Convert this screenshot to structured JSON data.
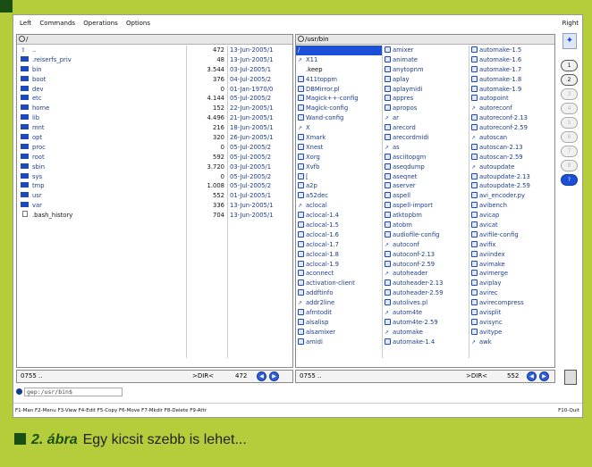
{
  "menu": {
    "items": [
      "Left",
      "Commands",
      "Operations",
      "Options"
    ],
    "right": "Right"
  },
  "left_panel": {
    "path": "/",
    "files": [
      {
        "name": "..",
        "size": "472",
        "date": "13-Jun-2005/1",
        "icon": "up"
      },
      {
        "name": ".reiserfs_priv",
        "size": "48",
        "date": "13-Jun-2005/1",
        "icon": "dir"
      },
      {
        "name": "bin",
        "size": "3.544",
        "date": "03-Jul-2005/1",
        "icon": "dir"
      },
      {
        "name": "boot",
        "size": "376",
        "date": "04-Jul-2005/2",
        "icon": "dir"
      },
      {
        "name": "dev",
        "size": "0",
        "date": "01-Jan-1970/0",
        "icon": "dir"
      },
      {
        "name": "etc",
        "size": "4.144",
        "date": "05-Jul-2005/2",
        "icon": "dir"
      },
      {
        "name": "home",
        "size": "152",
        "date": "22-Jun-2005/1",
        "icon": "dir"
      },
      {
        "name": "lib",
        "size": "4.496",
        "date": "21-Jun-2005/1",
        "icon": "dir"
      },
      {
        "name": "mnt",
        "size": "216",
        "date": "18-Jun-2005/1",
        "icon": "dir"
      },
      {
        "name": "opt",
        "size": "320",
        "date": "26-Jun-2005/1",
        "icon": "dir"
      },
      {
        "name": "proc",
        "size": "0",
        "date": "05-Jul-2005/2",
        "icon": "dir"
      },
      {
        "name": "root",
        "size": "592",
        "date": "05-Jul-2005/2",
        "icon": "dir"
      },
      {
        "name": "sbin",
        "size": "3.720",
        "date": "03-Jul-2005/1",
        "icon": "dir"
      },
      {
        "name": "sys",
        "size": "0",
        "date": "05-Jul-2005/2",
        "icon": "dir"
      },
      {
        "name": "tmp",
        "size": "1.008",
        "date": "05-Jul-2005/2",
        "icon": "dir"
      },
      {
        "name": "usr",
        "size": "552",
        "date": "01-Jul-2005/1",
        "icon": "dir"
      },
      {
        "name": "var",
        "size": "336",
        "date": "13-Jun-2005/1",
        "icon": "dir"
      },
      {
        "name": ".bash_history",
        "size": "704",
        "date": "13-Jun-2005/1",
        "icon": "file"
      }
    ],
    "status": {
      "perm": "0755 ..",
      "type": ">DIR<",
      "size": "472"
    }
  },
  "right_panel": {
    "path": "/usr/bin",
    "col1": [
      {
        "name": "/",
        "sel": true
      },
      {
        "name": "X11",
        "icon": "link"
      },
      {
        "name": ".keep",
        "icon": "none"
      },
      {
        "name": "411toppm",
        "icon": "bin"
      },
      {
        "name": "DBMirror.pl",
        "icon": "bin"
      },
      {
        "name": "Magick++-config",
        "icon": "bin"
      },
      {
        "name": "Magick-config",
        "icon": "bin"
      },
      {
        "name": "Wand-config",
        "icon": "bin"
      },
      {
        "name": "X",
        "icon": "link"
      },
      {
        "name": "Xmark",
        "icon": "bin"
      },
      {
        "name": "Xnest",
        "icon": "bin"
      },
      {
        "name": "Xorg",
        "icon": "bin"
      },
      {
        "name": "Xvfb",
        "icon": "bin"
      },
      {
        "name": "[",
        "icon": "bin"
      },
      {
        "name": "a2p",
        "icon": "bin"
      },
      {
        "name": "a52dec",
        "icon": "bin"
      },
      {
        "name": "aclocal",
        "icon": "link"
      },
      {
        "name": "aclocal-1.4",
        "icon": "bin"
      },
      {
        "name": "aclocal-1.5",
        "icon": "bin"
      },
      {
        "name": "aclocal-1.6",
        "icon": "bin"
      },
      {
        "name": "aclocal-1.7",
        "icon": "bin"
      },
      {
        "name": "aclocal-1.8",
        "icon": "bin"
      },
      {
        "name": "aclocal-1.9",
        "icon": "bin"
      },
      {
        "name": "aconnect",
        "icon": "bin"
      },
      {
        "name": "activation-client",
        "icon": "bin"
      },
      {
        "name": "addftinfo",
        "icon": "bin"
      },
      {
        "name": "addr2line",
        "icon": "link"
      },
      {
        "name": "afmtodit",
        "icon": "bin"
      },
      {
        "name": "alsalisp",
        "icon": "bin"
      },
      {
        "name": "alsamixer",
        "icon": "bin"
      },
      {
        "name": "amidi",
        "icon": "bin"
      }
    ],
    "col2": [
      {
        "name": "amixer",
        "icon": "bin"
      },
      {
        "name": "animate",
        "icon": "bin"
      },
      {
        "name": "anytopnm",
        "icon": "bin"
      },
      {
        "name": "aplay",
        "icon": "bin"
      },
      {
        "name": "aplaymidi",
        "icon": "bin"
      },
      {
        "name": "appres",
        "icon": "bin"
      },
      {
        "name": "apropos",
        "icon": "bin"
      },
      {
        "name": "ar",
        "icon": "link"
      },
      {
        "name": "arecord",
        "icon": "bin"
      },
      {
        "name": "arecordmidi",
        "icon": "bin"
      },
      {
        "name": "as",
        "icon": "link"
      },
      {
        "name": "asciitopgm",
        "icon": "bin"
      },
      {
        "name": "aseqdump",
        "icon": "bin"
      },
      {
        "name": "aseqnet",
        "icon": "bin"
      },
      {
        "name": "aserver",
        "icon": "bin"
      },
      {
        "name": "aspell",
        "icon": "bin"
      },
      {
        "name": "aspell-import",
        "icon": "bin"
      },
      {
        "name": "atktopbm",
        "icon": "bin"
      },
      {
        "name": "atobm",
        "icon": "bin"
      },
      {
        "name": "audiofile-config",
        "icon": "bin"
      },
      {
        "name": "autoconf",
        "icon": "link"
      },
      {
        "name": "autoconf-2.13",
        "icon": "bin"
      },
      {
        "name": "autoconf-2.59",
        "icon": "bin"
      },
      {
        "name": "autoheader",
        "icon": "link"
      },
      {
        "name": "autoheader-2.13",
        "icon": "bin"
      },
      {
        "name": "autoheader-2.59",
        "icon": "bin"
      },
      {
        "name": "autolives.pl",
        "icon": "bin"
      },
      {
        "name": "autom4te",
        "icon": "link"
      },
      {
        "name": "autom4te-2.59",
        "icon": "bin"
      },
      {
        "name": "automake",
        "icon": "link"
      },
      {
        "name": "automake-1.4",
        "icon": "bin"
      }
    ],
    "col3": [
      {
        "name": "automake-1.5",
        "icon": "bin"
      },
      {
        "name": "automake-1.6",
        "icon": "bin"
      },
      {
        "name": "automake-1.7",
        "icon": "bin"
      },
      {
        "name": "automake-1.8",
        "icon": "bin"
      },
      {
        "name": "automake-1.9",
        "icon": "bin"
      },
      {
        "name": "autopoint",
        "icon": "bin"
      },
      {
        "name": "autoreconf",
        "icon": "link"
      },
      {
        "name": "autoreconf-2.13",
        "icon": "bin"
      },
      {
        "name": "autoreconf-2.59",
        "icon": "bin"
      },
      {
        "name": "autoscan",
        "icon": "link"
      },
      {
        "name": "autoscan-2.13",
        "icon": "bin"
      },
      {
        "name": "autoscan-2.59",
        "icon": "bin"
      },
      {
        "name": "autoupdate",
        "icon": "link"
      },
      {
        "name": "autoupdate-2.13",
        "icon": "bin"
      },
      {
        "name": "autoupdate-2.59",
        "icon": "bin"
      },
      {
        "name": "avi_encoder.py",
        "icon": "bin"
      },
      {
        "name": "avibench",
        "icon": "bin"
      },
      {
        "name": "avicap",
        "icon": "bin"
      },
      {
        "name": "avicat",
        "icon": "bin"
      },
      {
        "name": "avifile-config",
        "icon": "bin"
      },
      {
        "name": "avifix",
        "icon": "bin"
      },
      {
        "name": "aviindex",
        "icon": "bin"
      },
      {
        "name": "avimake",
        "icon": "bin"
      },
      {
        "name": "avimerge",
        "icon": "bin"
      },
      {
        "name": "aviplay",
        "icon": "bin"
      },
      {
        "name": "avirec",
        "icon": "bin"
      },
      {
        "name": "avirecompress",
        "icon": "bin"
      },
      {
        "name": "avisplit",
        "icon": "bin"
      },
      {
        "name": "avisync",
        "icon": "bin"
      },
      {
        "name": "avitype",
        "icon": "bin"
      },
      {
        "name": "awk",
        "icon": "link"
      }
    ],
    "status": {
      "perm": "0755 ..",
      "type": ">DIR<",
      "size": "552"
    }
  },
  "cmdline": {
    "prompt": "gep:/usr/bin$"
  },
  "fkeys": {
    "left": "F1-Man F2-Menu F3-View F4-Edit F5-Copy F6-Move F7-Mkdir F8-Delete F9-Attr",
    "right": "F10-Quit"
  },
  "sidebar": {
    "buttons": [
      "1",
      "2",
      "3",
      "4",
      "5",
      "6",
      "7",
      "8",
      "?"
    ]
  },
  "caption": {
    "label": "2. ábra",
    "text": "Egy kicsit szebb is lehet..."
  },
  "colors": {
    "frame": "#b5cd3b",
    "accent": "#1a4f14",
    "selection": "#1b4fd8",
    "link": "#1c3d8c"
  }
}
